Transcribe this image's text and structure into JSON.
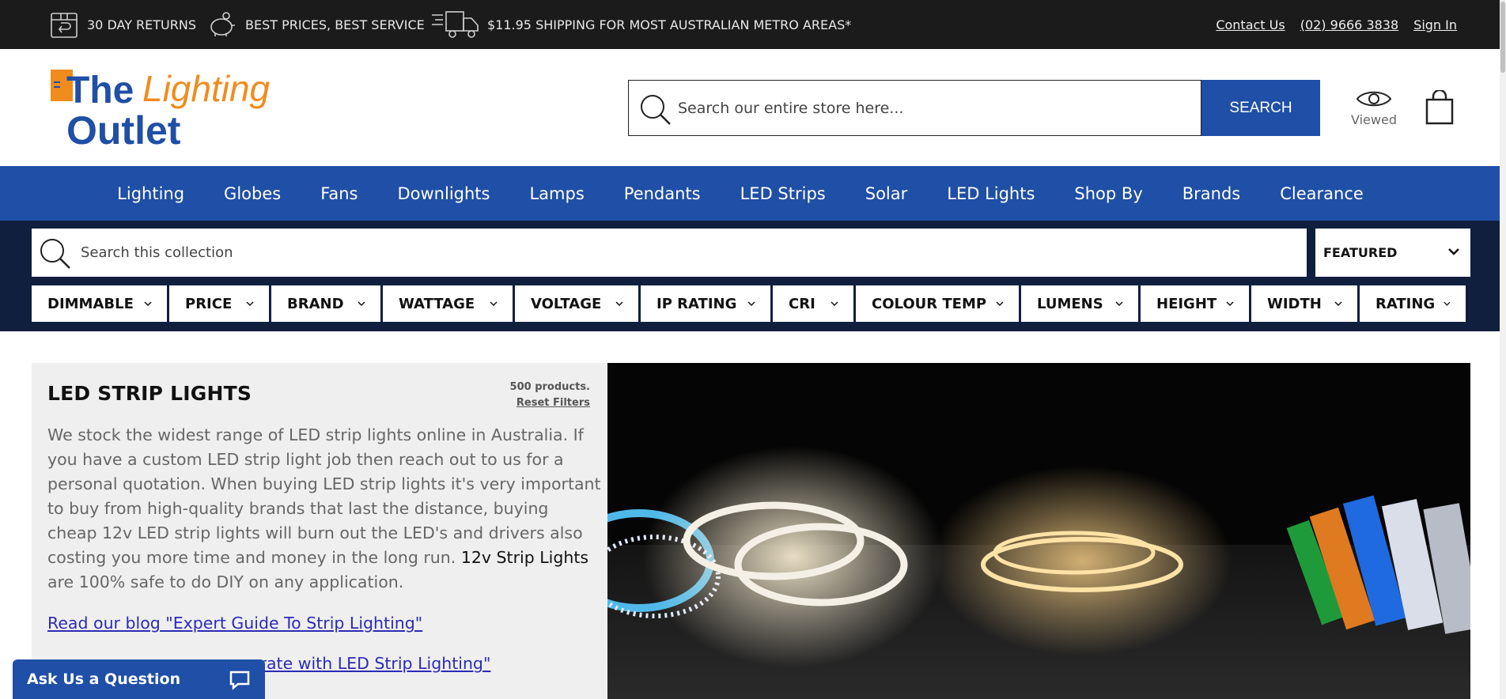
{
  "topbar": {
    "promo_returns": "30 DAY RETURNS",
    "promo_prices": "BEST PRICES, BEST SERVICE",
    "promo_shipping": "$11.95 SHIPPING FOR MOST AUSTRALIAN METRO AREAS*",
    "contact": "Contact Us",
    "phone": "(02) 9666 3838",
    "signin": "Sign In"
  },
  "header": {
    "logo_the": "The",
    "logo_lighting": "Lighting",
    "logo_outlet": "Outlet",
    "search_placeholder": "Search our entire store here...",
    "search_button": "SEARCH",
    "viewed_label": "Viewed"
  },
  "nav": {
    "items": [
      "Lighting",
      "Globes",
      "Fans",
      "Downlights",
      "Lamps",
      "Pendants",
      "LED Strips",
      "Solar",
      "LED Lights",
      "Shop By",
      "Brands",
      "Clearance"
    ]
  },
  "collection": {
    "search_placeholder": "Search this collection",
    "sort_value": "FEATURED",
    "filters": [
      "DIMMABLE",
      "PRICE",
      "BRAND",
      "WATTAGE",
      "VOLTAGE",
      "IP RATING",
      "CRI",
      "COLOUR TEMP",
      "LUMENS",
      "HEIGHT",
      "WIDTH",
      "RATING"
    ],
    "title": "LED STRIP LIGHTS",
    "product_count": "500 products.",
    "reset_filters": "Reset Filters",
    "description_part1": "We stock the widest range of LED strip lights online in Australia. If you have a custom LED strip light job then reach out to us for a personal quotation. When buying LED strip lights it's very important to buy from high-quality brands that last the distance, buying cheap 12v LED strip lights will burn out the LED's and drivers also costing you more time and money in the long run. ",
    "description_highlight": "12v Strip Lights",
    "description_part2": " are 100% safe to do DIY on any application.",
    "blog_link": "Read our blog \"Expert Guide To Strip Lighting\"",
    "blog_link2_visible": "orate with LED Strip Lighting\""
  },
  "chat": {
    "label": "Ask Us a Question"
  },
  "colors": {
    "brand_blue": "#1f4fa6",
    "logo_orange": "#f08c1e",
    "topbar_bg": "#1b1b1b",
    "filter_bar_bg": "#0f1f3d"
  }
}
